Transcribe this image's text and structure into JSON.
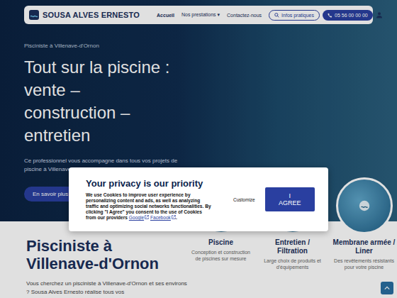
{
  "header": {
    "logo": "SOUSA ALVES ERNESTO",
    "nav": [
      {
        "label": "Accueil",
        "selected": true
      },
      {
        "label": "Nos prestations",
        "selected": false,
        "caret": "▾"
      },
      {
        "label": "Contactez-nous",
        "selected": false
      }
    ],
    "info_button": "Infos pratiques",
    "phone_button": "05 56 00 00 00"
  },
  "hero": {
    "kicker": "Pisciniste à Villenave-d'Ornon",
    "title_lines": [
      "Tout sur la piscine :",
      "vente –",
      "construction –",
      "entretien"
    ],
    "text": "Ce professionnel vous accompagne dans tous vos projets de piscine à Villenave-d'Ornon.",
    "button": "En savoir plus"
  },
  "cookie": {
    "title": "Your privacy is our priority",
    "text": "We use Cookies to improve user experience by personalizing content and ads, as well as analyzing traffic and optimizing social networks functionalities. By clicking \"I Agree\" you consent to the use of Cookies from our providers",
    "links": [
      "Google",
      "Facebook"
    ],
    "end": ".",
    "customize": "Customize",
    "agree": "I AGREE"
  },
  "intro": {
    "title_lines": [
      "Pisciniste à",
      "Villenave-d'Ornon"
    ],
    "text": "Vous cherchez un pisciniste à Villenave-d'Ornon et ses environs ? Sousa Alves Ernesto réalise tous vos"
  },
  "services": [
    {
      "title": "Piscine",
      "text": "Conception et construction de piscines sur mesure"
    },
    {
      "title": "Entretien / Filtration",
      "text": "Large choix de produits et d'équipements"
    },
    {
      "title": "Membrane armée / Liner",
      "text": "Des revêtements résistants pour votre piscine"
    }
  ]
}
